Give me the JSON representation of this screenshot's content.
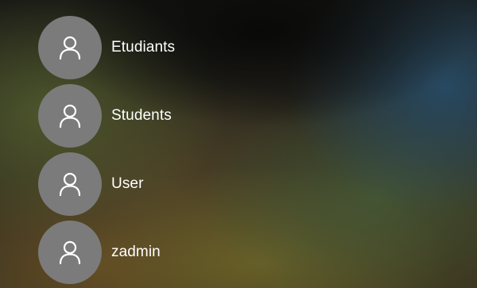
{
  "accounts": [
    {
      "name": "Etudiants",
      "icon": "user-icon"
    },
    {
      "name": "Students",
      "icon": "user-icon"
    },
    {
      "name": "User",
      "icon": "user-icon"
    },
    {
      "name": "zadmin",
      "icon": "user-icon"
    }
  ],
  "colors": {
    "avatar_background": "#7b7b7b",
    "text": "#ffffff"
  }
}
